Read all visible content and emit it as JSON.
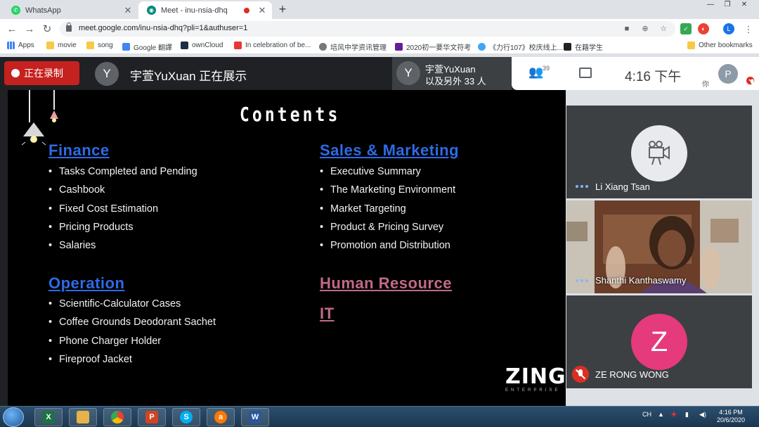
{
  "browser": {
    "tabs": [
      {
        "title": "WhatsApp",
        "favicon": "whatsapp-icon",
        "favicon_color": "#25d366",
        "active": false
      },
      {
        "title": "Meet - inu-nsia-dhq",
        "favicon": "meet-icon",
        "favicon_color": "#00897b",
        "active": true,
        "recording": true
      }
    ],
    "url": "meet.google.com/inu-nsia-dhq?pli=1&authuser=1",
    "profile_initial": "L",
    "bookmarks": [
      {
        "label": "Apps",
        "icon": "apps-grid-icon"
      },
      {
        "label": "movie",
        "icon": "folder-icon"
      },
      {
        "label": "song",
        "icon": "folder-icon"
      },
      {
        "label": "Google 翻譯",
        "icon": "google-translate-icon"
      },
      {
        "label": "ownCloud",
        "icon": "owncloud-icon"
      },
      {
        "label": "In celebration of be...",
        "icon": "t-icon"
      },
      {
        "label": "培风中学资讯管理",
        "icon": "globe-icon"
      },
      {
        "label": "2020初一要华文符考",
        "icon": "bookmark-icon"
      },
      {
        "label": "《力行107》校庆线上...",
        "icon": "bookmark-icon"
      },
      {
        "label": "在籍学生",
        "icon": "wix-icon"
      }
    ],
    "other_bookmarks": "Other bookmarks"
  },
  "meet": {
    "recording_label": "正在录制",
    "presenter_initial": "Y",
    "presenting_text": "宇萱YuXuan 正在展示",
    "pinned": {
      "initial": "Y",
      "line1": "宇萱YuXuan",
      "line2": "以及另外 33 人"
    },
    "participant_count": "39",
    "time": "4:16 下午",
    "self": {
      "initial": "P",
      "label": "你"
    },
    "colors": {
      "recording": "#c5221f",
      "accent": "#1a73e8",
      "muted": "#d93025"
    }
  },
  "slide": {
    "title": "Contents",
    "sections": {
      "finance": {
        "heading": "Finance",
        "items": [
          "Tasks Completed and Pending",
          "Cashbook",
          "Fixed Cost Estimation",
          "Pricing Products",
          "Salaries"
        ]
      },
      "sales": {
        "heading": "Sales & Marketing",
        "items": [
          "Executive Summary",
          "The Marketing Environment",
          "Market Targeting",
          "Product & Pricing Survey",
          "Promotion and Distribution"
        ]
      },
      "operation": {
        "heading": "Operation",
        "items": [
          "Scientific-Calculator Cases",
          "Coffee Grounds Deodorant Sachet",
          "Phone Charger Holder",
          "Fireproof Jacket"
        ]
      },
      "hr": {
        "heading": "Human Resource"
      },
      "it": {
        "heading": "IT"
      }
    },
    "logo_text": "ZING",
    "logo_sub": "ENTERPRISE",
    "colors": {
      "heading_blue": "#2d6be6",
      "heading_pink": "#c06a87"
    }
  },
  "participants": [
    {
      "name": "Li Xiang Tsan",
      "state": "camera-off"
    },
    {
      "name": "Shanthi Kanthaswamy",
      "state": "video"
    },
    {
      "name": "ZE RONG WONG",
      "initial": "Z",
      "state": "muted",
      "avatar_color": "#e53a7c"
    }
  ],
  "taskbar": {
    "apps": [
      {
        "name": "excel",
        "glyph": "X",
        "color": "#1e7145"
      },
      {
        "name": "explorer",
        "glyph": "",
        "color": "#e6b34a"
      },
      {
        "name": "chrome",
        "glyph": "",
        "color": "#4285f4"
      },
      {
        "name": "powerpoint",
        "glyph": "P",
        "color": "#d04423"
      },
      {
        "name": "skype",
        "glyph": "S",
        "color": "#00aff0"
      },
      {
        "name": "avast",
        "glyph": "a",
        "color": "#ff7800"
      },
      {
        "name": "word",
        "glyph": "W",
        "color": "#2b579a"
      }
    ],
    "lang": "CH",
    "time": "4:16 PM",
    "date": "20/6/2020"
  }
}
